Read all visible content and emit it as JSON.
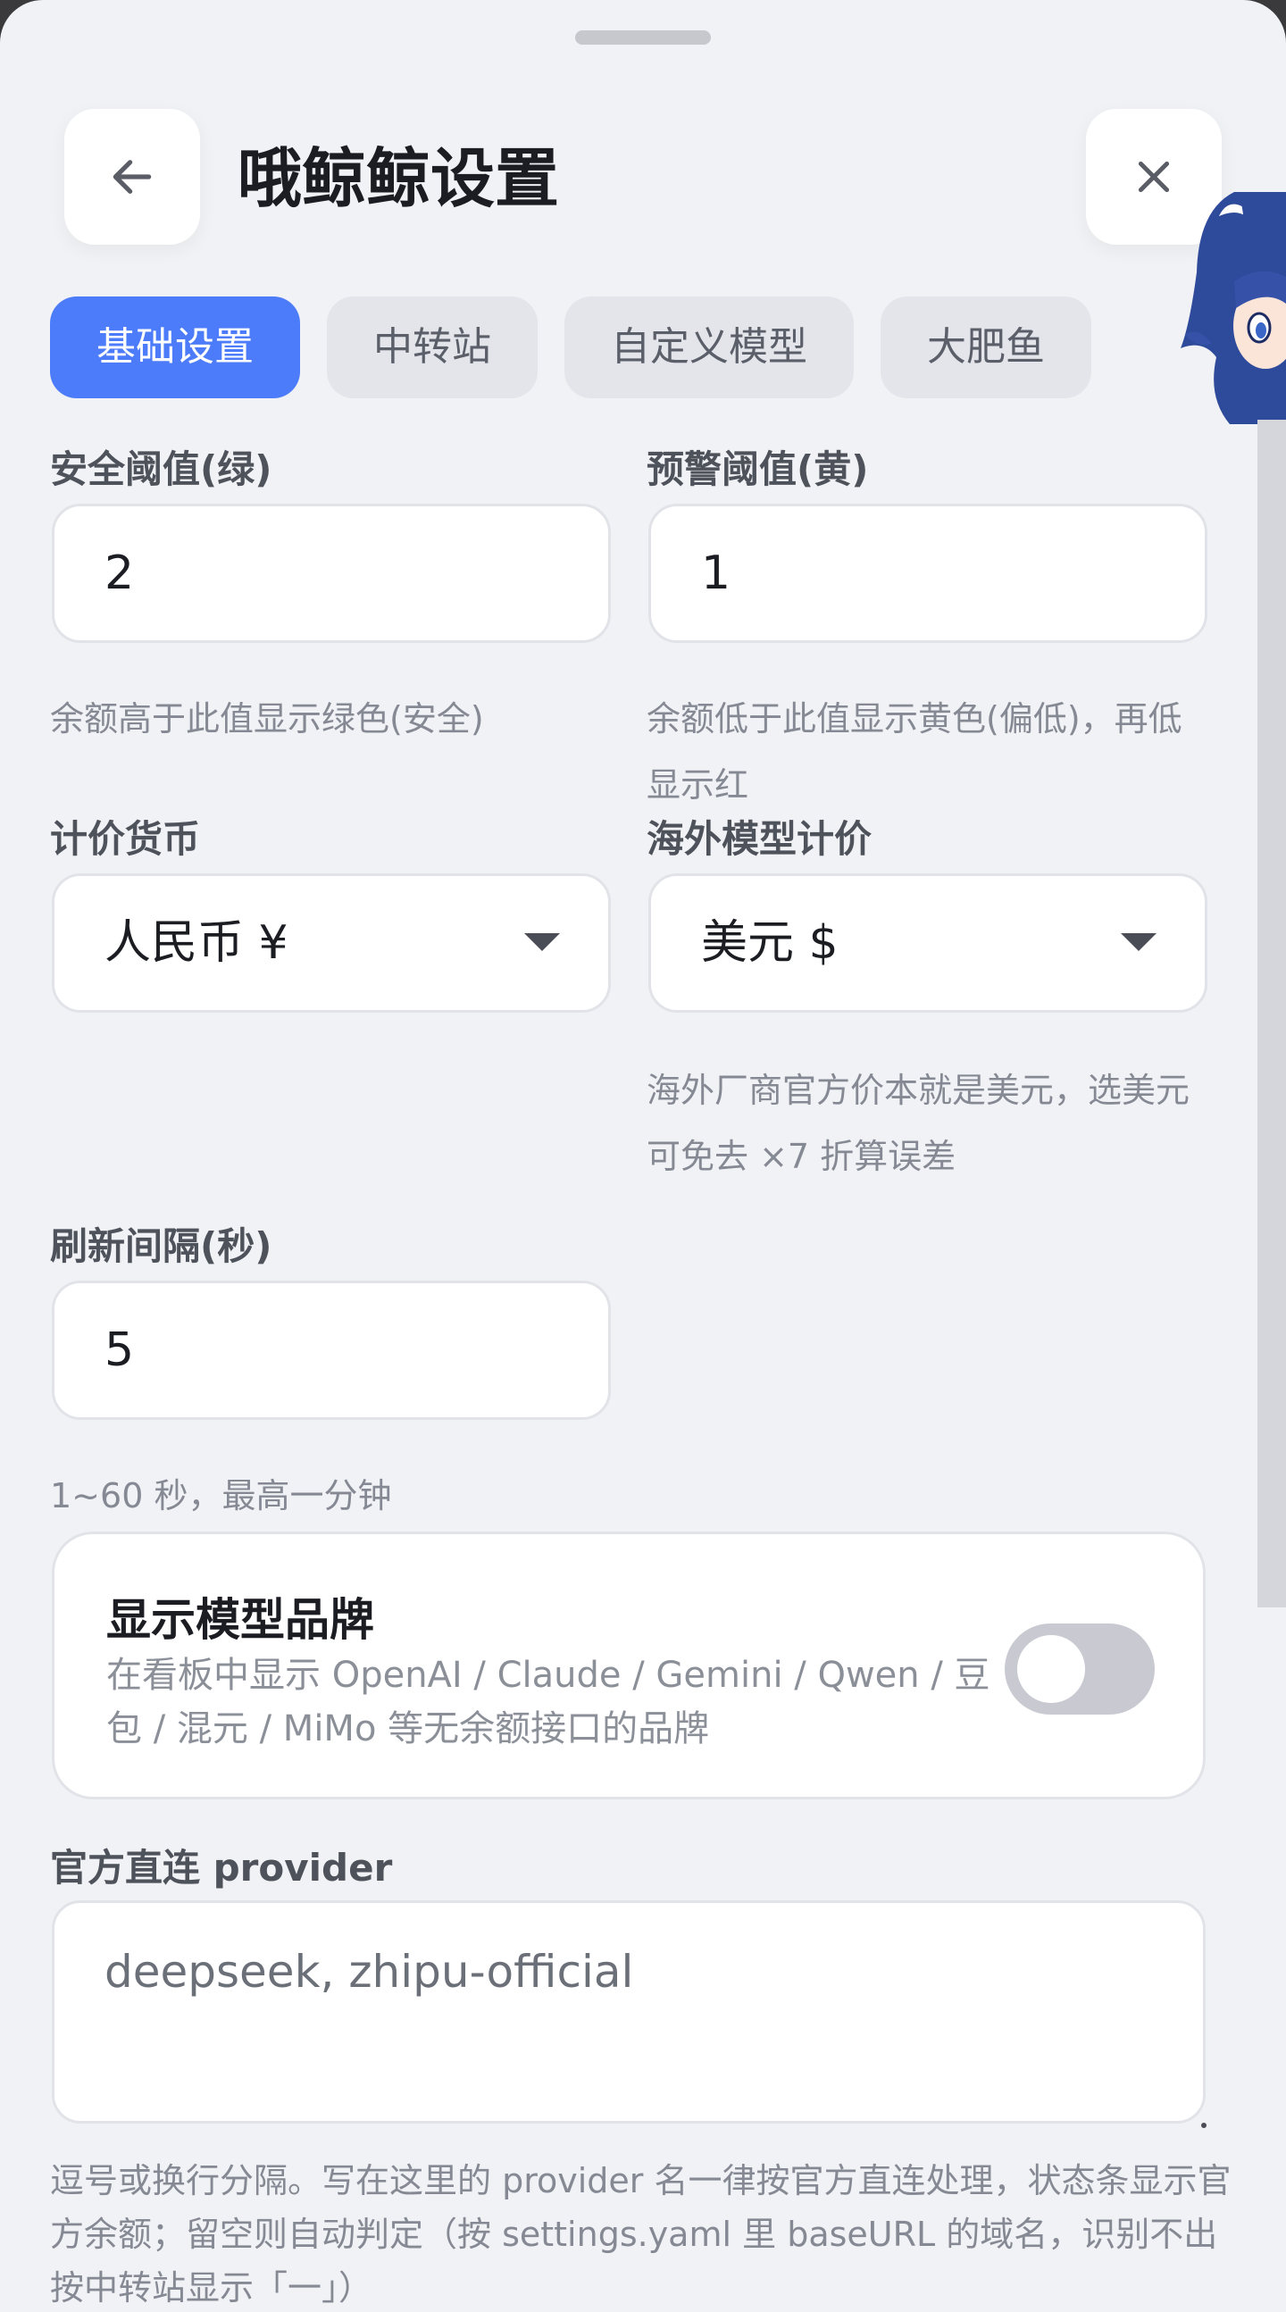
{
  "header": {
    "title": "哦鲸鲸设置",
    "back_icon": "arrow-left-icon",
    "close_icon": "close-icon"
  },
  "tabs": [
    {
      "label": "基础设置",
      "active": true
    },
    {
      "label": "中转站",
      "active": false
    },
    {
      "label": "自定义模型",
      "active": false
    },
    {
      "label": "大肥鱼",
      "active": false
    }
  ],
  "fields": {
    "safe_threshold": {
      "label": "安全阈值(绿)",
      "value": "2",
      "help": "余额高于此值显示绿色(安全)"
    },
    "warn_threshold": {
      "label": "预警阈值(黄)",
      "value": "1",
      "help": "余额低于此值显示黄色(偏低)，再低显示红"
    },
    "currency": {
      "label": "计价货币",
      "value": "人民币 ¥"
    },
    "overseas_pricing": {
      "label": "海外模型计价",
      "value": "美元 $",
      "help": "海外厂商官方价本就是美元，选美元可免去 ×7 折算误差"
    },
    "refresh_interval": {
      "label": "刷新间隔(秒)",
      "value": "5",
      "help": "1~60 秒，最高一分钟"
    }
  },
  "brand_card": {
    "title": "显示模型品牌",
    "description": "在看板中显示 OpenAI / Claude / Gemini / Qwen / 豆包 / 混元 / MiMo 等无余额接口的品牌",
    "toggle_on": false
  },
  "provider": {
    "label": "官方直连 provider",
    "value": "deepseek, zhipu-official",
    "help": "逗号或换行分隔。写在这里的 provider 名一律按官方直连处理，状态条显示官方余额；留空则自动判定（按 settings.yaml 里 baseURL 的域名，识别不出按中转站显示「一」）"
  },
  "colors": {
    "accent": "#4d7cfa",
    "background": "#f1f2f5",
    "toggle_off": "#c9cad1"
  }
}
